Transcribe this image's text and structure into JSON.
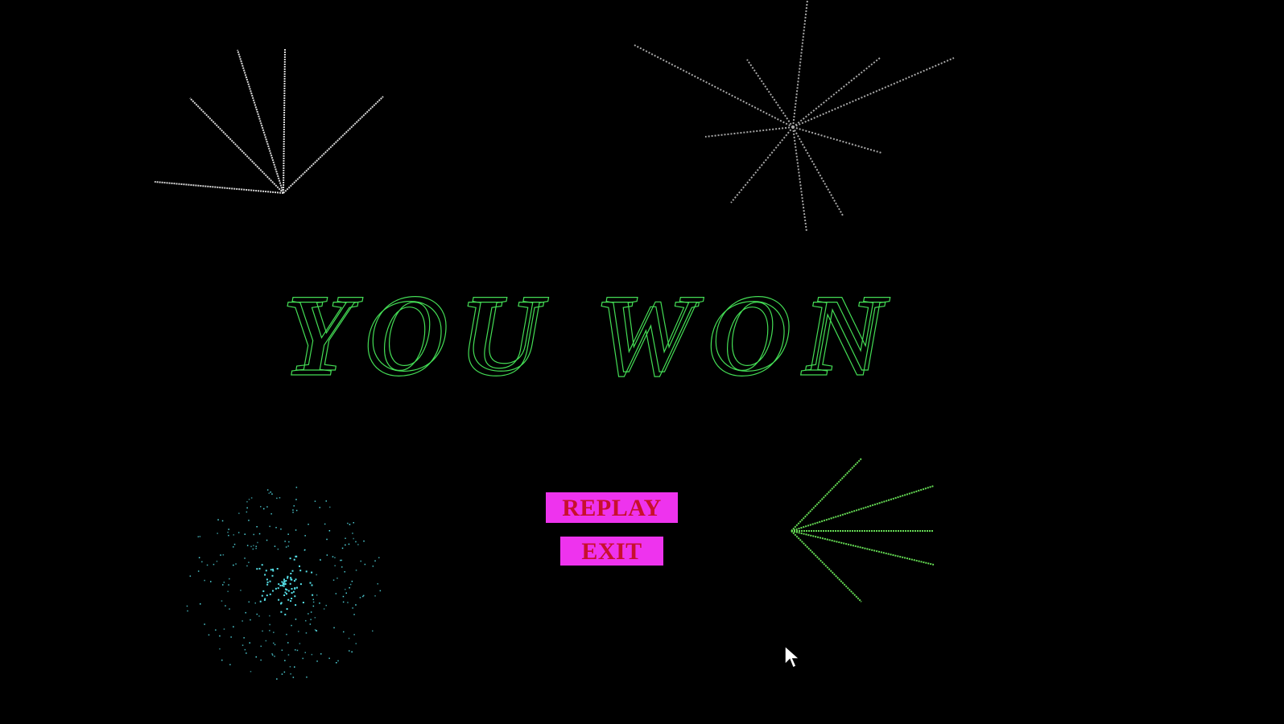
{
  "title": "YOU WON",
  "menu": {
    "replay_label": "REPLAY",
    "exit_label": "EXIT"
  },
  "colors": {
    "background": "#000000",
    "title_outline": "#44dd55",
    "button_fill": "#ee33ee",
    "button_text": "#c8102e",
    "firework_white": "#d8d8d8",
    "firework_gray": "#a8a8a8",
    "firework_cyan": "#55e0e8",
    "firework_green": "#66dd55"
  },
  "icons": {
    "pointer": "arrow-cursor-icon"
  }
}
